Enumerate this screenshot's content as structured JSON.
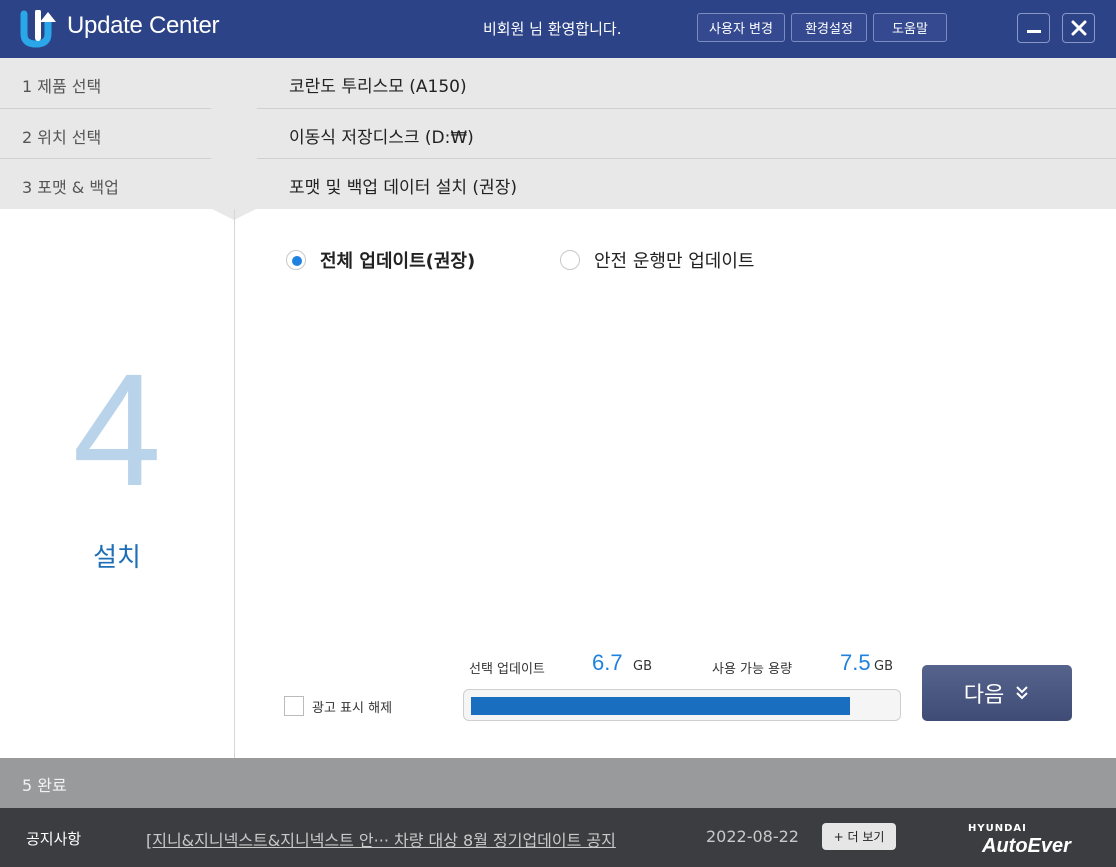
{
  "app": {
    "title": "Update Center",
    "welcome": "비회원 님 환영합니다.",
    "buttons": {
      "change_user": "사용자 변경",
      "settings": "환경설정",
      "help": "도움말"
    }
  },
  "steps": [
    {
      "label": "1  제품 선택",
      "value": "코란도 투리스모 (A150)"
    },
    {
      "label": "2  위치 선택",
      "value": "이동식 저장디스크 (D:₩)"
    },
    {
      "label": "3  포맷 & 백업",
      "value": "포맷 및 백업 데이터 설치 (권장)"
    }
  ],
  "current_step": {
    "number": "4",
    "label": "설치"
  },
  "options": {
    "full": "전체 업데이트(권장)",
    "safety": "안전 운행만 업데이트",
    "selected": "full"
  },
  "ad": {
    "label": "광고 표시 해제"
  },
  "storage": {
    "selected_label": "선택 업데이트",
    "selected_value": "6.7",
    "selected_unit": "GB",
    "available_label": "사용 가능 용량",
    "available_value": "7.5",
    "available_unit": "GB",
    "usage_fraction": 0.893
  },
  "next_button": {
    "label": "다음",
    "icon": "double-chevron-down-icon"
  },
  "step5": {
    "label": "5  완료"
  },
  "footer": {
    "notice_label": "공지사항",
    "notice_text": "[지니&지니넥스트&지니넥스트  안··· 차량 대상 8월 정기업데이트 공지",
    "notice_date": "2022-08-22",
    "more_button": "+ 더 보기",
    "brand_top": "HYUNDAI",
    "brand": "AutoEver"
  },
  "colors": {
    "titlebar": "#2d4387",
    "accent": "#1f82e0",
    "progress": "#1a6ebf",
    "footer": "#3b3d41"
  }
}
